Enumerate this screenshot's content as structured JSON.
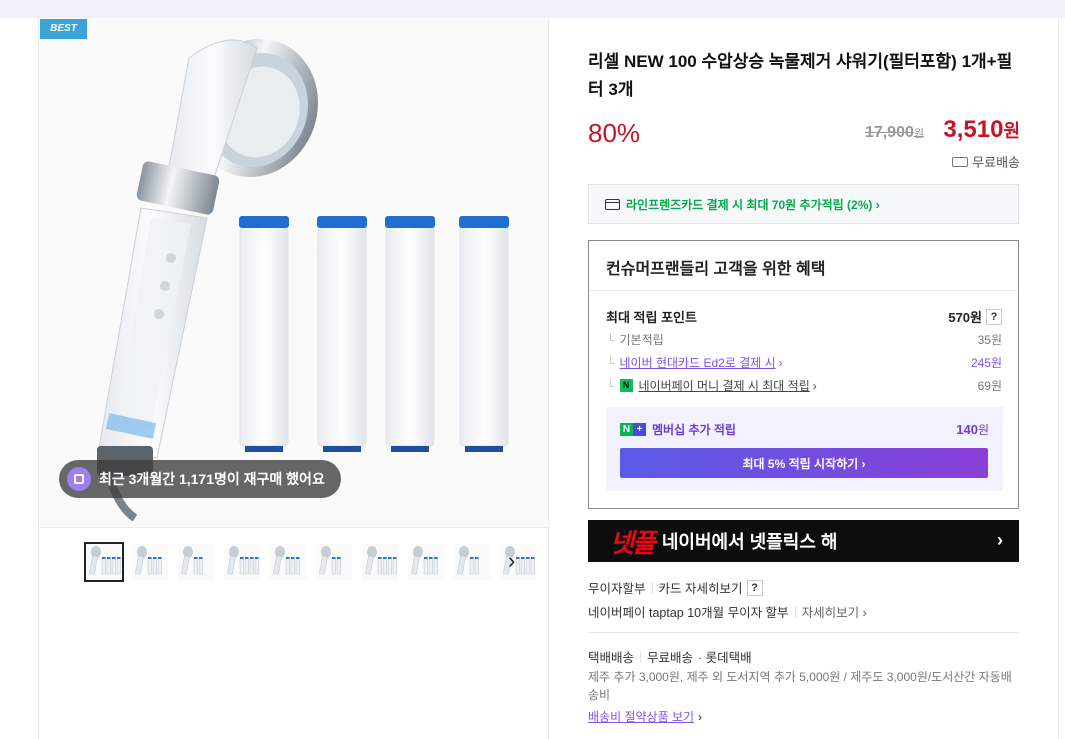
{
  "badge": {
    "best": "BEST"
  },
  "repurchase": {
    "text": "최근 3개월간 1,171명이 재구매 했어요"
  },
  "thumbnails": {
    "count": 10,
    "next_glyph": "›"
  },
  "product": {
    "title": "리셀 NEW 100 수압상승 녹물제거 샤워기(필터포함) 1개+필터 3개",
    "discount": "80%",
    "original_price": "17,900",
    "original_unit": "원",
    "price": "3,510",
    "price_unit": "원",
    "shipping": "무료배송"
  },
  "card_banner": {
    "text": "라인프렌즈카드 결제 시 최대 70원 추가적립 (2%) ›"
  },
  "benefits": {
    "title": "컨슈머프랜들리 고객을 위한 혜택",
    "max_points_label": "최대 적립 포인트",
    "max_points_amount": "570원",
    "help": "?",
    "rows": [
      {
        "label": "기본적립",
        "amount": "35원"
      },
      {
        "label": "네이버 현대카드 Ed2로 결제 시",
        "suffix": "›",
        "amount": "245원"
      },
      {
        "label": "네이버페이 머니 결제 시 최대 적립",
        "suffix": "›",
        "amount": "69원"
      }
    ],
    "membership": {
      "label": "멤버십 추가 적립",
      "amount": "140",
      "unit": "원",
      "button": "최대 5% 적립 시작하기 ›"
    }
  },
  "netflix": {
    "logo": "넷플",
    "text": "네이버에서 넷플릭스 해",
    "arrow": "›"
  },
  "installment": {
    "label": "무이자할부",
    "card_detail": "카드 자세히보기",
    "help": "?",
    "npay_text": "네이버페이 taptap 10개월 무이자 할부",
    "npay_detail": "자세히보기 ›"
  },
  "delivery": {
    "type": "택배배송",
    "fee": "무료배송",
    "courier": "· 롯데택배",
    "extra": "제주 추가 3,000원, 제주 외 도서지역 추가 5,000원 / 제주도 3,000원/도서산간 자동배송비",
    "saving_link": "배송비 절약상품 보기",
    "saving_chev": "›"
  },
  "colors": {
    "accent_red": "#c5142a",
    "npay_green": "#07a94d",
    "membership_purple": "#6f3ad6",
    "best_blue": "#3ba3d6"
  }
}
